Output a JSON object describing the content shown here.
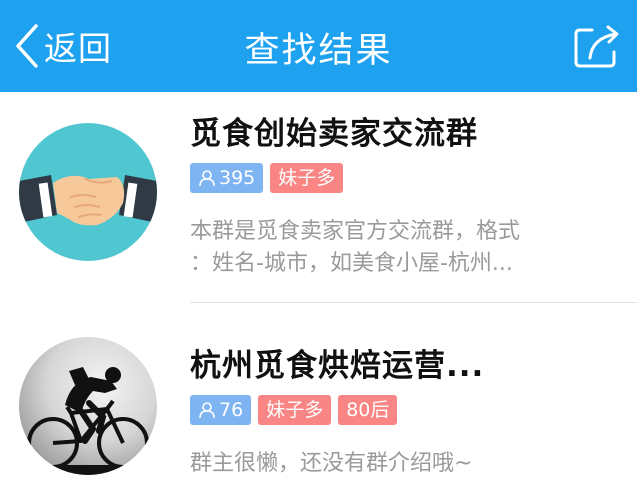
{
  "header": {
    "back_label": "返回",
    "title": "查找结果"
  },
  "results": [
    {
      "name": "觅食创始卖家交流群",
      "member_count": "395",
      "tags": [
        "妹子多"
      ],
      "description_line1": "本群是觅食卖家官方交流群，格式",
      "description_line2": "：姓名-城市，如美食小屋-杭州..."
    },
    {
      "name": "杭州觅食烘焙运营...",
      "member_count": "76",
      "tags": [
        "妹子多",
        "80后"
      ],
      "description_line1": "群主很懒，还没有群介绍哦~"
    }
  ],
  "colors": {
    "header_bg": "#1ea2f0",
    "count_tag_bg": "#7fb4f2",
    "feature_tag_bg": "#f98585",
    "handshake_avatar_bg": "#4fc6d0"
  },
  "icons": [
    "chevron-left-icon",
    "share-icon",
    "person-icon",
    "handshake-icon",
    "cyclist-icon"
  ]
}
